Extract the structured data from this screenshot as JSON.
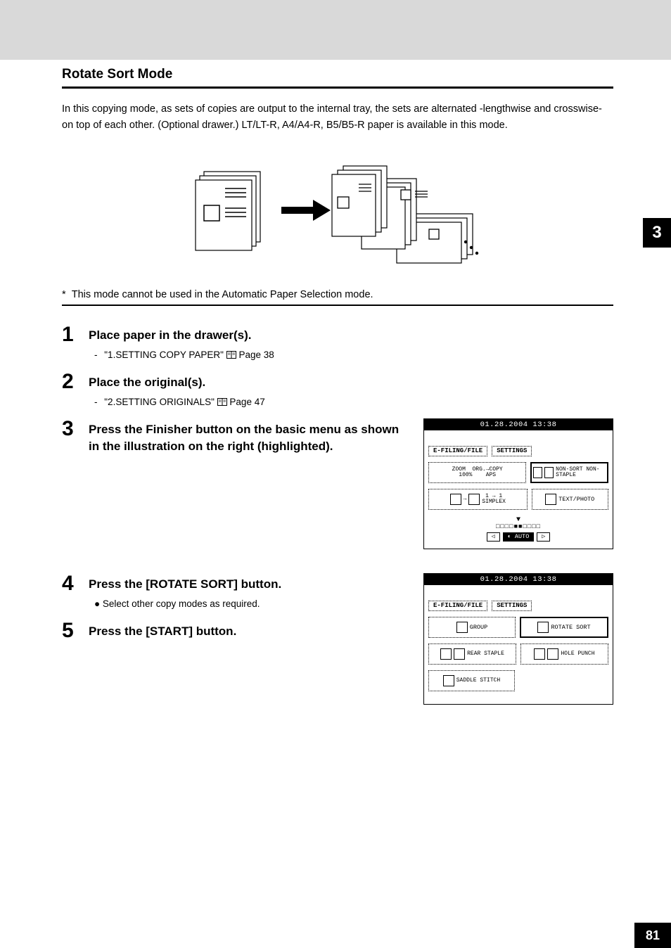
{
  "chapter_tab": "3",
  "page_number": "81",
  "heading": "Rotate Sort Mode",
  "intro": "In this copying mode, as sets of copies are output to the internal tray, the sets are alternated -lengthwise and crosswise- on top of each other. (Optional drawer.) LT/LT-R, A4/A4-R, B5/B5-R paper is available in this mode.",
  "note_prefix": "*",
  "note": "This mode cannot be used in the Automatic Paper Selection mode.",
  "steps": {
    "s1": {
      "num": "1",
      "title": "Place paper in the drawer(s).",
      "ref_label": "\"1.SETTING COPY PAPER\"",
      "ref_page": "Page 38"
    },
    "s2": {
      "num": "2",
      "title": "Place the original(s).",
      "ref_label": "\"2.SETTING ORIGINALS\"",
      "ref_page": "Page 47"
    },
    "s3": {
      "num": "3",
      "title": "Press the Finisher button on the basic menu as shown in the illustration on the right (highlighted)."
    },
    "s4": {
      "num": "4",
      "title": "Press the [ROTATE SORT] button.",
      "bullet": "Select other copy modes as required."
    },
    "s5": {
      "num": "5",
      "title": "Press the [START] button."
    }
  },
  "screen1": {
    "datetime": "01.28.2004 13:38",
    "tab1": "E-FILING/FILE",
    "tab2": "SETTINGS",
    "zoom_line1": "ZOOM",
    "zoom_line2": "100%",
    "org_copy": "ORG.→COPY",
    "aps": "APS",
    "nonsort": "NON-SORT NON-STAPLE",
    "simplex_top": "1 → 1",
    "simplex": "SIMPLEX",
    "textphoto": "TEXT/PHOTO",
    "auto": "AUTO"
  },
  "screen2": {
    "datetime": "01.28.2004 13:38",
    "tab1": "E-FILING/FILE",
    "tab2": "SETTINGS",
    "group": "GROUP",
    "rotate_sort": "ROTATE SORT",
    "rear_staple": "REAR STAPLE",
    "hole_punch": "HOLE PUNCH",
    "saddle_stitch": "SADDLE STITCH"
  }
}
